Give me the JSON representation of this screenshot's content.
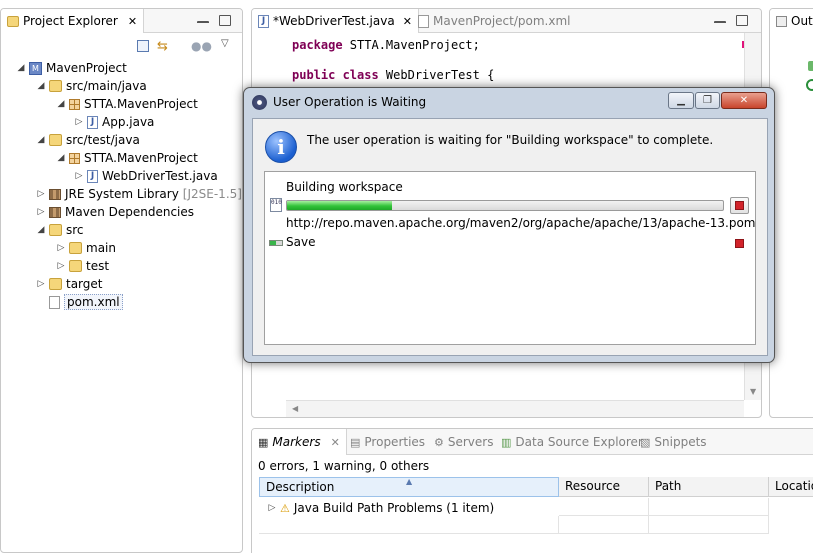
{
  "explorer": {
    "title": "Project Explorer",
    "tree": [
      {
        "label": "MavenProject",
        "extra": "",
        "icon": "project-icon"
      },
      {
        "label": "src/main/java",
        "extra": "",
        "icon": "source-folder-icon"
      },
      {
        "label": "STTA.MavenProject",
        "extra": "",
        "icon": "package-icon"
      },
      {
        "label": "App.java",
        "extra": "",
        "icon": "java-file-icon"
      },
      {
        "label": "src/test/java",
        "extra": "",
        "icon": "source-folder-icon"
      },
      {
        "label": "STTA.MavenProject",
        "extra": "",
        "icon": "package-icon"
      },
      {
        "label": "WebDriverTest.java",
        "extra": "",
        "icon": "java-file-icon"
      },
      {
        "label": "JRE System Library",
        "extra": "[J2SE-1.5]",
        "icon": "library-icon"
      },
      {
        "label": "Maven Dependencies",
        "extra": "",
        "icon": "library-icon"
      },
      {
        "label": "src",
        "extra": "",
        "icon": "folder-icon"
      },
      {
        "label": "main",
        "extra": "",
        "icon": "folder-icon"
      },
      {
        "label": "test",
        "extra": "",
        "icon": "folder-icon"
      },
      {
        "label": "target",
        "extra": "",
        "icon": "folder-icon"
      },
      {
        "label": "pom.xml",
        "extra": "",
        "icon": "xml-file-icon"
      }
    ]
  },
  "editor": {
    "tabs": [
      {
        "label": "*WebDriverTest.java",
        "active": true
      },
      {
        "label": "MavenProject/pom.xml",
        "active": false
      }
    ],
    "code": [
      {
        "kw": "package",
        "rest": " STTA.MavenProject;"
      },
      {
        "kw": "public class",
        "rest": " WebDriverTest {"
      }
    ]
  },
  "outline": {
    "title": "Outl"
  },
  "markers": {
    "tabs": [
      "Markers",
      "Properties",
      "Servers",
      "Data Source Explorer",
      "Snippets"
    ],
    "summary": "0 errors, 1 warning, 0 others",
    "columns": [
      "Description",
      "Resource",
      "Path",
      "Location"
    ],
    "rows": [
      {
        "description": "Java Build Path Problems (1 item)"
      }
    ]
  },
  "dialog": {
    "title": "User Operation is Waiting",
    "message": "The user operation is waiting for \"Building workspace\" to complete.",
    "operations": [
      {
        "name": "Building workspace",
        "detail": "http://repo.maven.apache.org/maven2/org/apache/apache/13/apache-13.pom",
        "progress": 0.24
      },
      {
        "name": "Save"
      }
    ]
  },
  "colors": {
    "keyword": "#7f0055",
    "progress": "#33c33a",
    "stop": "#d2232a",
    "dialog_frame": "#c9d4e2"
  }
}
